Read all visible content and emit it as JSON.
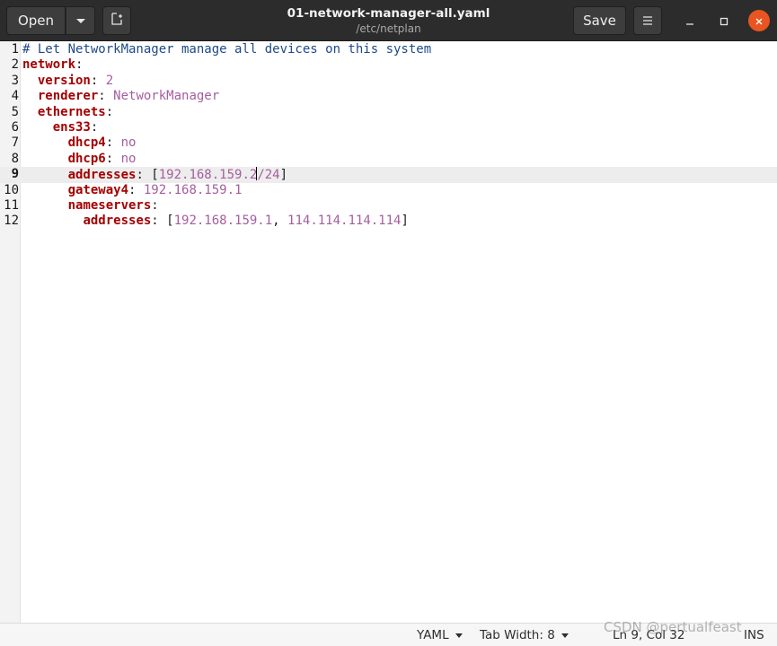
{
  "header": {
    "open_label": "Open",
    "title": "01-network-manager-all.yaml",
    "subtitle": "/etc/netplan",
    "save_label": "Save"
  },
  "editor": {
    "current_line": 9,
    "lines": [
      {
        "num": "1",
        "parts": [
          {
            "t": "# Let NetworkManager manage all devices on this system",
            "c": "cmt"
          }
        ]
      },
      {
        "num": "2",
        "parts": [
          {
            "t": "network",
            "c": "key"
          },
          {
            "t": ":",
            "c": "pun"
          }
        ]
      },
      {
        "num": "3",
        "parts": [
          {
            "t": "  ",
            "c": "pun"
          },
          {
            "t": "version",
            "c": "key"
          },
          {
            "t": ": ",
            "c": "pun"
          },
          {
            "t": "2",
            "c": "val"
          }
        ]
      },
      {
        "num": "4",
        "parts": [
          {
            "t": "  ",
            "c": "pun"
          },
          {
            "t": "renderer",
            "c": "key"
          },
          {
            "t": ": ",
            "c": "pun"
          },
          {
            "t": "NetworkManager",
            "c": "val"
          }
        ]
      },
      {
        "num": "5",
        "parts": [
          {
            "t": "  ",
            "c": "pun"
          },
          {
            "t": "ethernets",
            "c": "key"
          },
          {
            "t": ":",
            "c": "pun"
          }
        ]
      },
      {
        "num": "6",
        "parts": [
          {
            "t": "    ",
            "c": "pun"
          },
          {
            "t": "ens33",
            "c": "key"
          },
          {
            "t": ":",
            "c": "pun"
          }
        ]
      },
      {
        "num": "7",
        "parts": [
          {
            "t": "      ",
            "c": "pun"
          },
          {
            "t": "dhcp4",
            "c": "key"
          },
          {
            "t": ": ",
            "c": "pun"
          },
          {
            "t": "no",
            "c": "val"
          }
        ]
      },
      {
        "num": "8",
        "parts": [
          {
            "t": "      ",
            "c": "pun"
          },
          {
            "t": "dhcp6",
            "c": "key"
          },
          {
            "t": ": ",
            "c": "pun"
          },
          {
            "t": "no",
            "c": "val"
          }
        ]
      },
      {
        "num": "9",
        "parts": [
          {
            "t": "      ",
            "c": "pun"
          },
          {
            "t": "addresses",
            "c": "key"
          },
          {
            "t": ": [",
            "c": "pun"
          },
          {
            "t": "192.168.159.2",
            "c": "val"
          },
          {
            "t": "",
            "c": "caret"
          },
          {
            "t": "/24",
            "c": "val"
          },
          {
            "t": "]",
            "c": "pun"
          }
        ]
      },
      {
        "num": "10",
        "parts": [
          {
            "t": "      ",
            "c": "pun"
          },
          {
            "t": "gateway4",
            "c": "key"
          },
          {
            "t": ": ",
            "c": "pun"
          },
          {
            "t": "192.168.159.1",
            "c": "val"
          }
        ]
      },
      {
        "num": "11",
        "parts": [
          {
            "t": "      ",
            "c": "pun"
          },
          {
            "t": "nameservers",
            "c": "key"
          },
          {
            "t": ":",
            "c": "pun"
          }
        ]
      },
      {
        "num": "12",
        "parts": [
          {
            "t": "        ",
            "c": "pun"
          },
          {
            "t": "addresses",
            "c": "key"
          },
          {
            "t": ": [",
            "c": "pun"
          },
          {
            "t": "192.168.159.1",
            "c": "val"
          },
          {
            "t": ", ",
            "c": "pun"
          },
          {
            "t": "114.114.114.114",
            "c": "val"
          },
          {
            "t": "]",
            "c": "pun"
          }
        ]
      }
    ]
  },
  "statusbar": {
    "language": "YAML",
    "tab_width": "Tab Width: 8",
    "position": "Ln 9, Col 32",
    "mode": "INS"
  },
  "watermark": "CSDN @pertualfeast",
  "colors": {
    "headerbar": "#2c2c2c",
    "close_button": "#e95420",
    "comment": "#204a87",
    "key": "#a40000",
    "value": "#a55e9e",
    "current_line": "#ededed"
  }
}
